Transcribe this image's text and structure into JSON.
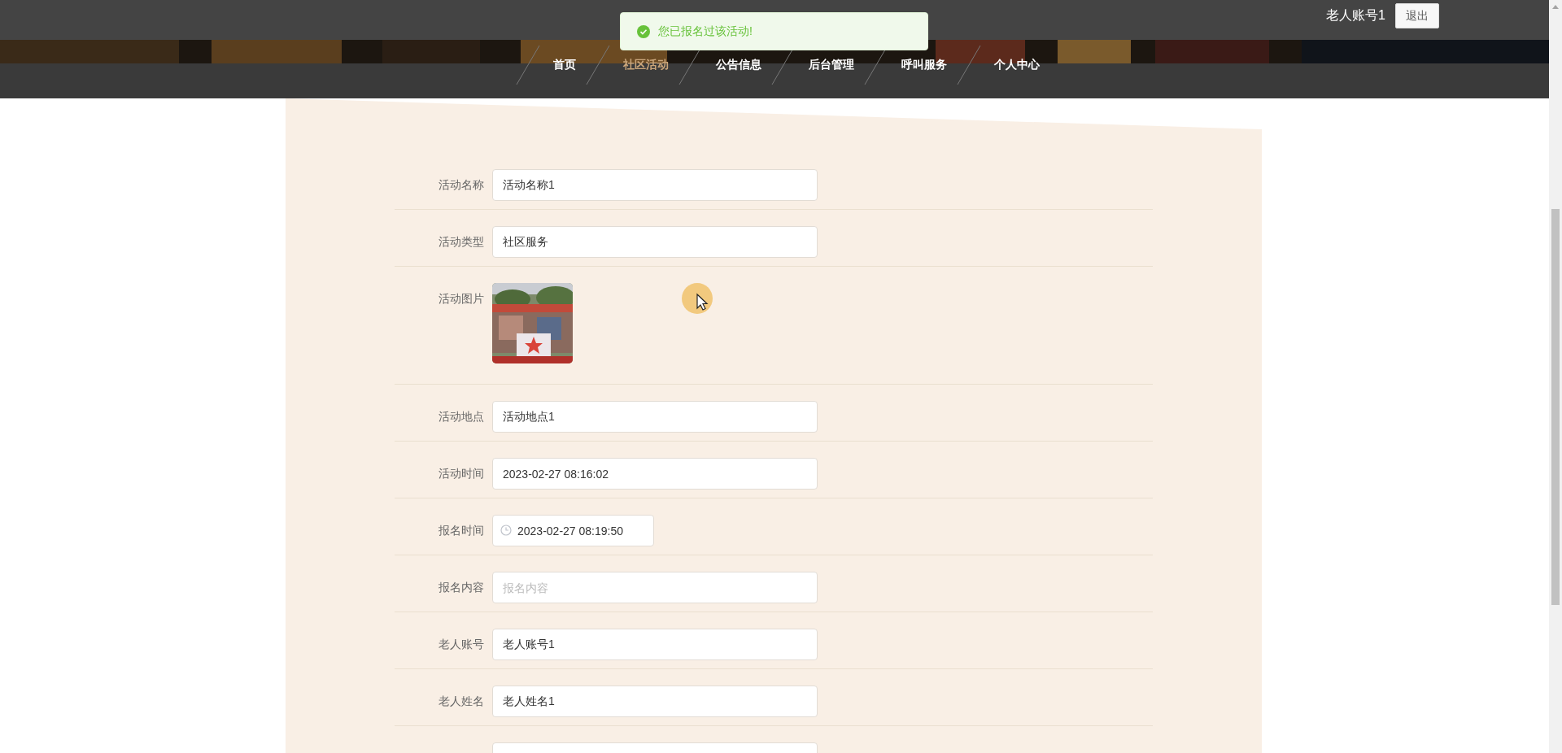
{
  "header": {
    "user": "老人账号1",
    "logout": "退出"
  },
  "toast": {
    "kind": "success",
    "message": "您已报名过该活动!"
  },
  "nav": [
    {
      "label": "首页",
      "selected": false
    },
    {
      "label": "社区活动",
      "selected": true
    },
    {
      "label": "公告信息",
      "selected": false
    },
    {
      "label": "后台管理",
      "selected": false
    },
    {
      "label": "呼叫服务",
      "selected": false
    },
    {
      "label": "个人中心",
      "selected": false
    }
  ],
  "form": [
    {
      "label": "活动名称",
      "kind": "input",
      "value": "活动名称1"
    },
    {
      "label": "活动类型",
      "kind": "input",
      "value": "社区服务"
    },
    {
      "label": "活动图片"
    },
    {
      "label": "活动地点",
      "kind": "input",
      "value": "活动地点1"
    },
    {
      "label": "活动时间",
      "kind": "input",
      "value": "2023-02-27 08:16:02"
    },
    {
      "label": "报名时间",
      "kind": "datetime",
      "value": "2023-02-27 08:19:50"
    },
    {
      "label": "报名内容",
      "kind": "input",
      "placeholder": "报名内容"
    },
    {
      "label": "老人账号",
      "kind": "input",
      "value": "老人账号1"
    },
    {
      "label": "老人姓名",
      "kind": "input",
      "value": "老人姓名1"
    },
    {
      "kind": "input"
    }
  ]
}
